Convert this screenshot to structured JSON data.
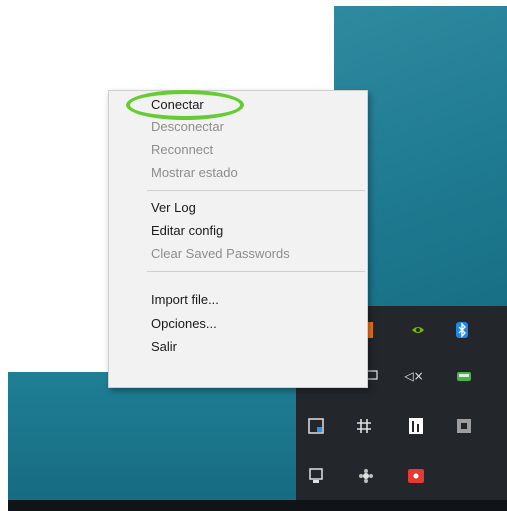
{
  "menu": {
    "items": [
      {
        "label": "Conectar",
        "enabled": true,
        "highlighted": true
      },
      {
        "label": "Desconectar",
        "enabled": false
      },
      {
        "label": "Reconnect",
        "enabled": false
      },
      {
        "label": "Mostrar estado",
        "enabled": false
      },
      {
        "label": "Ver Log",
        "enabled": true
      },
      {
        "label": "Editar config",
        "enabled": true
      },
      {
        "label": "Clear Saved Passwords",
        "enabled": false
      },
      {
        "label": "Import file...",
        "enabled": true
      },
      {
        "label": "Opciones...",
        "enabled": true
      },
      {
        "label": "Salir",
        "enabled": true
      }
    ]
  },
  "tray": {
    "icons": [
      "orange-app-icon",
      "nvidia-icon",
      "bluetooth-icon",
      "network-icon",
      "mute-speaker-icon",
      "green-app-icon",
      "remote-desktop-icon",
      "slack-icon",
      "app-bars-icon",
      "window-icon",
      "usb-device-icon",
      "flower-app-icon",
      "red-app-icon"
    ],
    "glyphs": {
      "mute": "◁×"
    }
  },
  "colors": {
    "highlight_ring": "#66cc33",
    "menu_background": "#f2f2f2",
    "desktop": "#1f7b92",
    "tray_panel": "#23272c"
  }
}
